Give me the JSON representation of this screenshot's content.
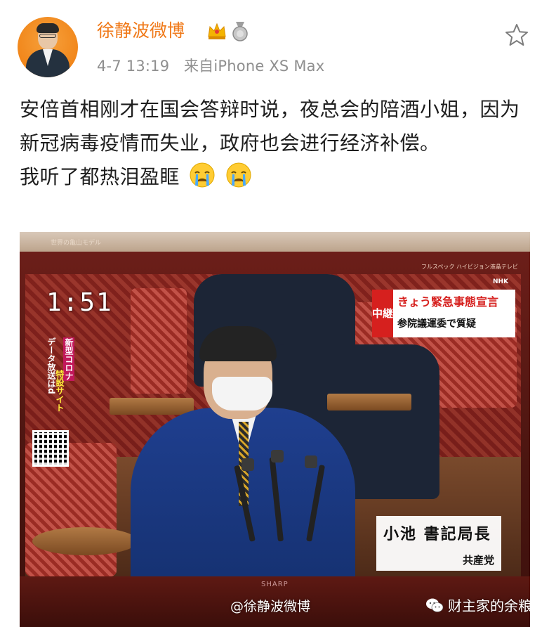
{
  "post": {
    "username": "徐静波微博",
    "timestamp": "4-7 13:19",
    "source": "来自iPhone XS Max",
    "badges": [
      "crown-icon",
      "medal-icon"
    ],
    "text_lines": [
      "安倍首相刚才在国会答辩时说，夜总会的陪酒小姐，因为新冠病毒疫情而失业，政府也会进行经济补偿。",
      "我听了都热泪盈眶"
    ],
    "emojis": [
      "crying-face-icon",
      "crying-face-icon"
    ]
  },
  "photo": {
    "tv_top_label": "世界の亀山モデル",
    "tv_brand_label": "フルスペック ハイビジョン液晶テレビ",
    "clock": "1:51",
    "side_text_1": "新型コロナ",
    "side_text_2": "特設サイト",
    "side_text_3": "データ放送はd",
    "news_tag": "中継",
    "news_line1": "きょう緊急事態宣言",
    "news_line2": "参院議運委で質疑",
    "nhk": "NHK",
    "name_main": "小池 書記局長",
    "name_party": "共産党",
    "tv_brand": "SHARP",
    "watermark_weibo": "@徐静波微博",
    "watermark_wechat": "财主家的余粮"
  },
  "colors": {
    "username": "#f07a1a",
    "meta": "#8f8f8f",
    "text": "#1e1e1e",
    "news_red": "#d6201e"
  }
}
